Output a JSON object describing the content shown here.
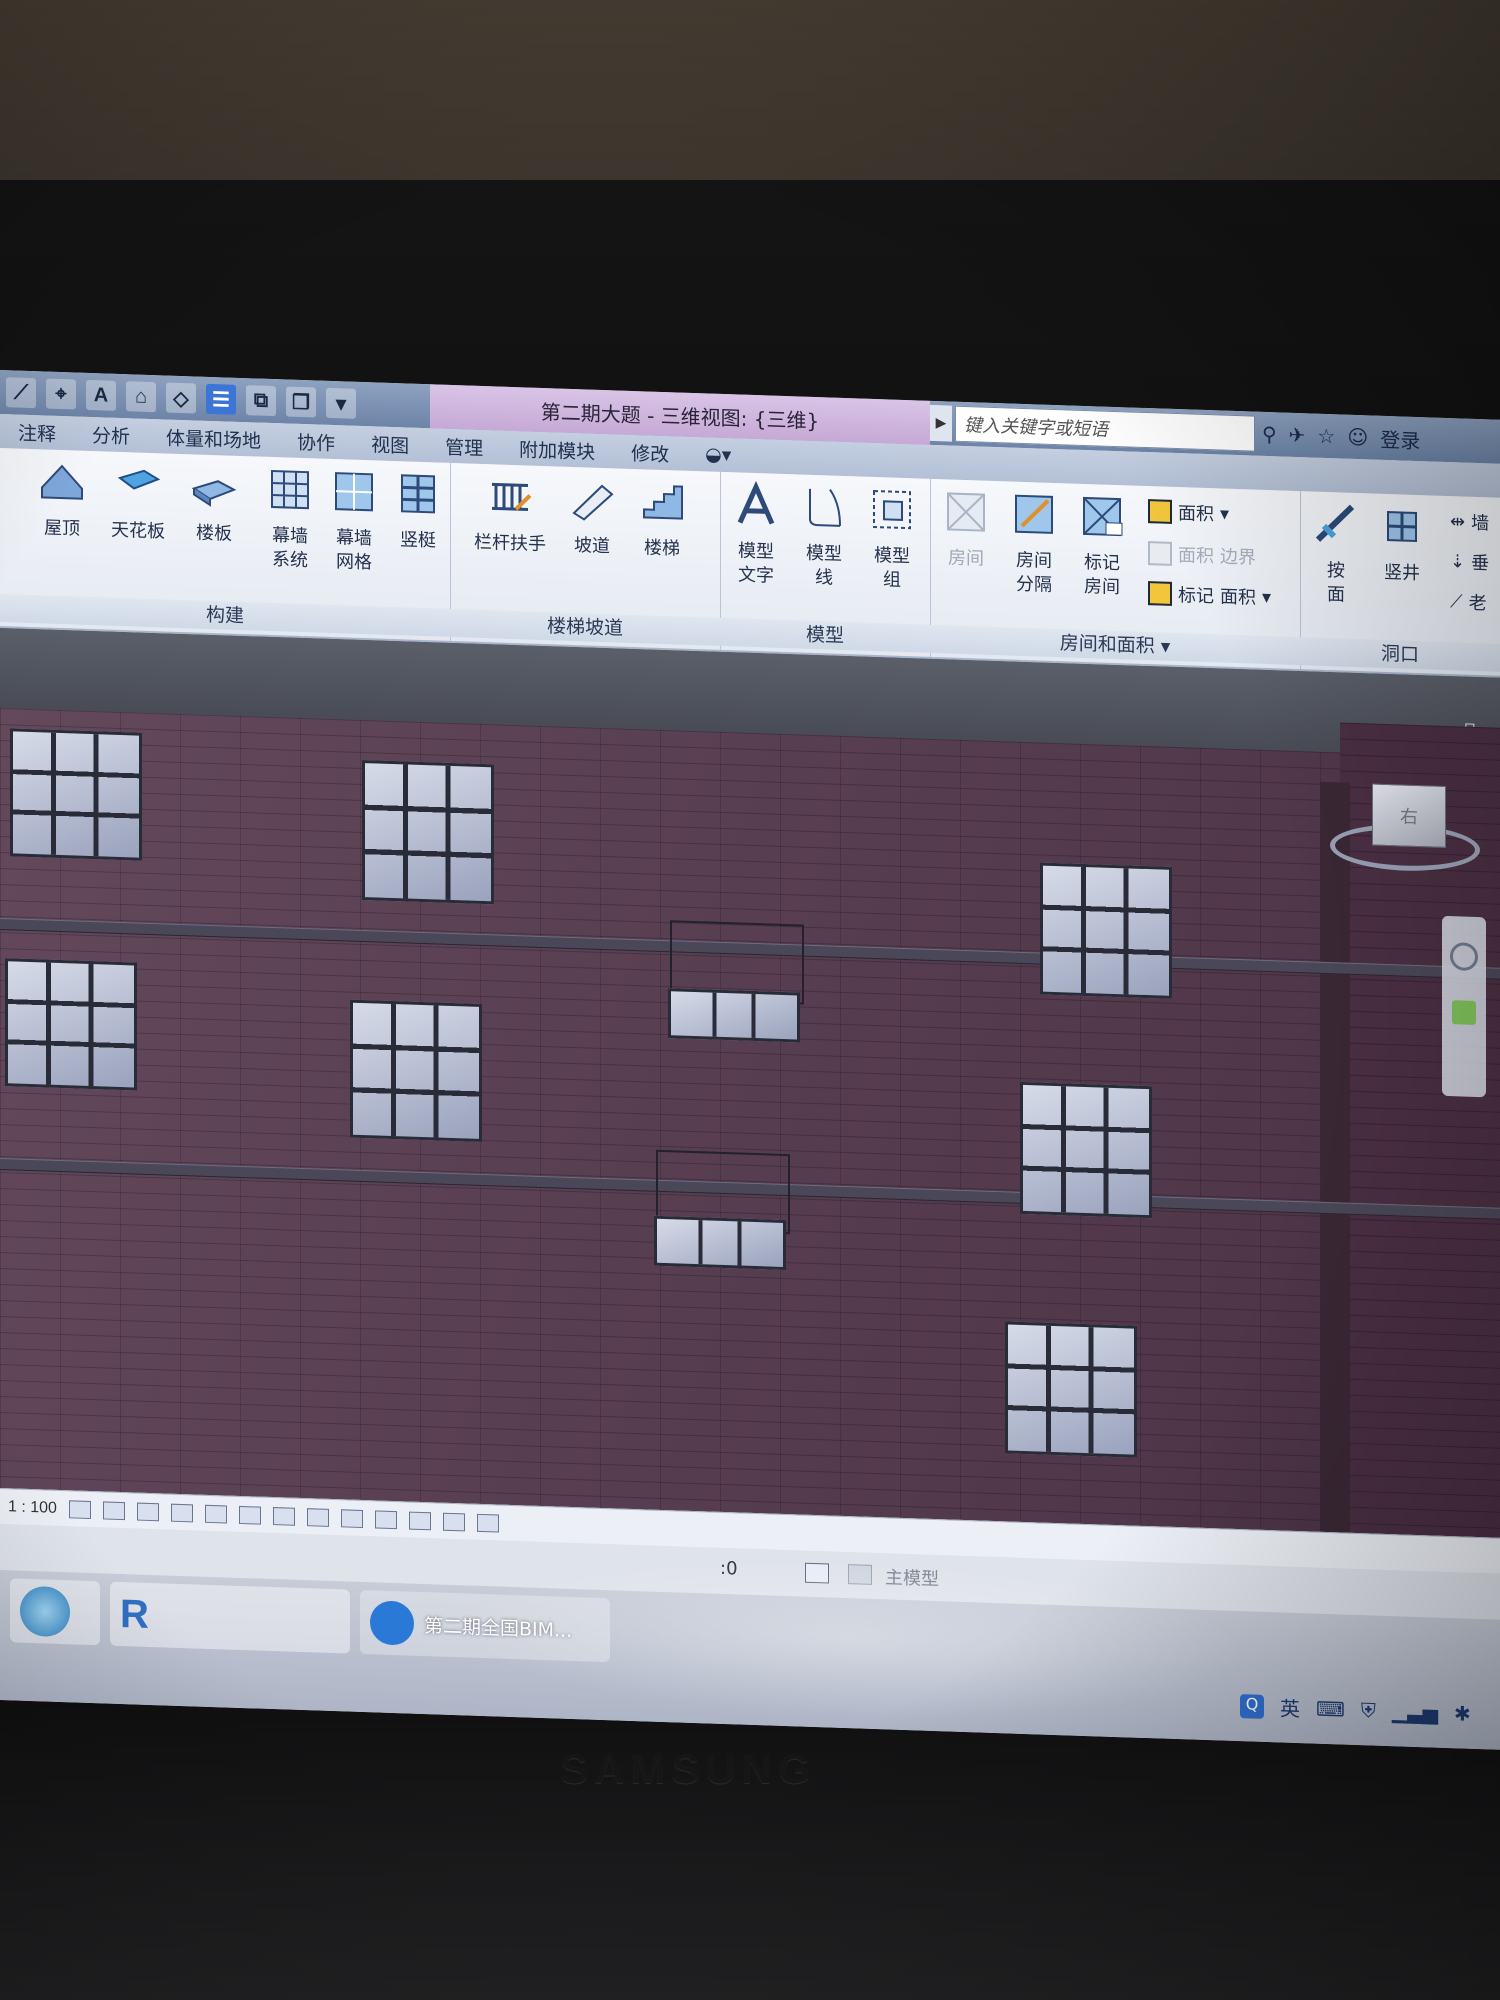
{
  "window": {
    "title": "第二期大题 - 三维视图: {三维}",
    "search_placeholder": "键入关键字或短语",
    "login_label": "登录"
  },
  "quick_access": {
    "text_tool_glyph": "A"
  },
  "tabs": [
    "注释",
    "分析",
    "体量和场地",
    "协作",
    "视图",
    "管理",
    "附加模块",
    "修改"
  ],
  "ribbon": {
    "build": {
      "title": "构建",
      "roof": "屋顶",
      "ceiling": "天花板",
      "floor": "楼板",
      "curtain_system_1": "幕墙",
      "curtain_system_2": "系统",
      "curtain_grid_1": "幕墙",
      "curtain_grid_2": "网格",
      "mullion": "竖梃"
    },
    "circulation": {
      "title": "楼梯坡道",
      "railing": "栏杆扶手",
      "ramp": "坡道",
      "stair": "楼梯"
    },
    "model": {
      "title": "模型",
      "text_1": "模型",
      "text_2": "文字",
      "line_1": "模型",
      "line_2": "线",
      "group_1": "模型",
      "group_2": "组"
    },
    "room_area": {
      "title": "房间和面积",
      "room": "房间",
      "separator_1": "房间",
      "separator_2": "分隔",
      "tag_1": "标记",
      "tag_2": "房间",
      "area": "面积",
      "area_boundary_1": "面积",
      "area_boundary_2": "边界",
      "tag_area_1": "标记",
      "tag_area_2": "面积"
    },
    "opening": {
      "title": "洞口",
      "by_face_1": "按",
      "by_face_2": "面",
      "shaft": "竖井",
      "wall": "墙",
      "vertical": "垂",
      "dormer": "老"
    }
  },
  "viewport": {
    "viewcube_face": "右"
  },
  "view_control": {
    "scale": "1 : 100"
  },
  "status": {
    "selection_count": ":0",
    "workset": "主模型"
  },
  "taskbar": {
    "revit_glyph": "R",
    "app_label": "第二期全国BIM...",
    "ime": "英"
  },
  "monitor": {
    "brand": "SAMSUNG"
  },
  "colors": {
    "brick": "#5a3d52",
    "title_bar": "#c6a9d6",
    "accent": "#3b76d6"
  }
}
